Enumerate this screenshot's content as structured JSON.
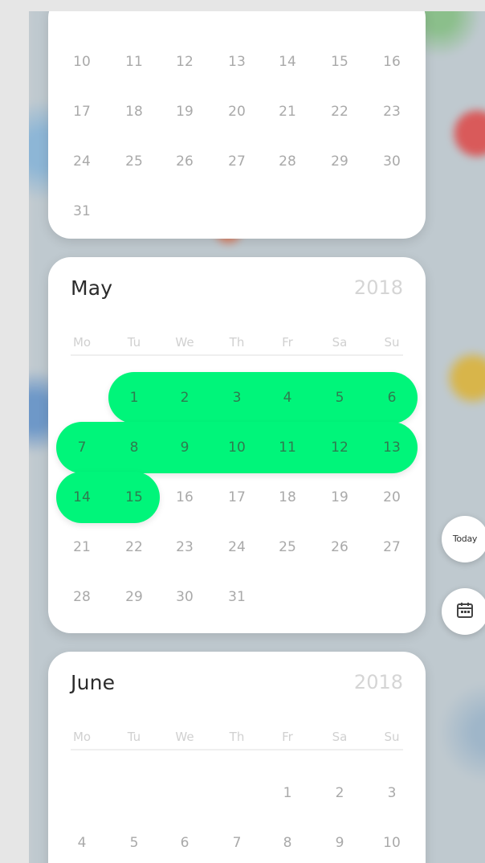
{
  "months": [
    {
      "weeks": [
        [
          "10",
          "11",
          "12",
          "13",
          "14",
          "15",
          "16"
        ],
        [
          "17",
          "18",
          "19",
          "20",
          "21",
          "22",
          "23"
        ],
        [
          "24",
          "25",
          "26",
          "27",
          "28",
          "29",
          "30"
        ],
        [
          "31",
          "",
          "",
          "",
          "",
          "",
          ""
        ]
      ]
    },
    {
      "name": "May",
      "year": "2018",
      "weekdays": [
        "Mo",
        "Tu",
        "We",
        "Th",
        "Fr",
        "Sa",
        "Su"
      ],
      "weeks": [
        [
          "",
          "1",
          "2",
          "3",
          "4",
          "5",
          "6"
        ],
        [
          "7",
          "8",
          "9",
          "10",
          "11",
          "12",
          "13"
        ],
        [
          "14",
          "15",
          "16",
          "17",
          "18",
          "19",
          "20"
        ],
        [
          "21",
          "22",
          "23",
          "24",
          "25",
          "26",
          "27"
        ],
        [
          "28",
          "29",
          "30",
          "31",
          "",
          "",
          ""
        ]
      ],
      "selected_range": [
        "1",
        "15"
      ]
    },
    {
      "name": "June",
      "year": "2018",
      "weekdays": [
        "Mo",
        "Tu",
        "We",
        "Th",
        "Fr",
        "Sa",
        "Su"
      ],
      "weeks": [
        [
          "",
          "",
          "",
          "",
          "1",
          "2",
          "3"
        ],
        [
          "4",
          "5",
          "6",
          "7",
          "8",
          "9",
          "10"
        ]
      ]
    }
  ],
  "controls": {
    "today_label": "Today",
    "calendar_icon": "calendar-icon"
  },
  "colors": {
    "selection": "#00f57a",
    "selected_text": "#2f7a4f",
    "day_text": "#a9a9a9",
    "weekday_text": "#d0d0d0",
    "year_text": "#d5d5d5"
  }
}
